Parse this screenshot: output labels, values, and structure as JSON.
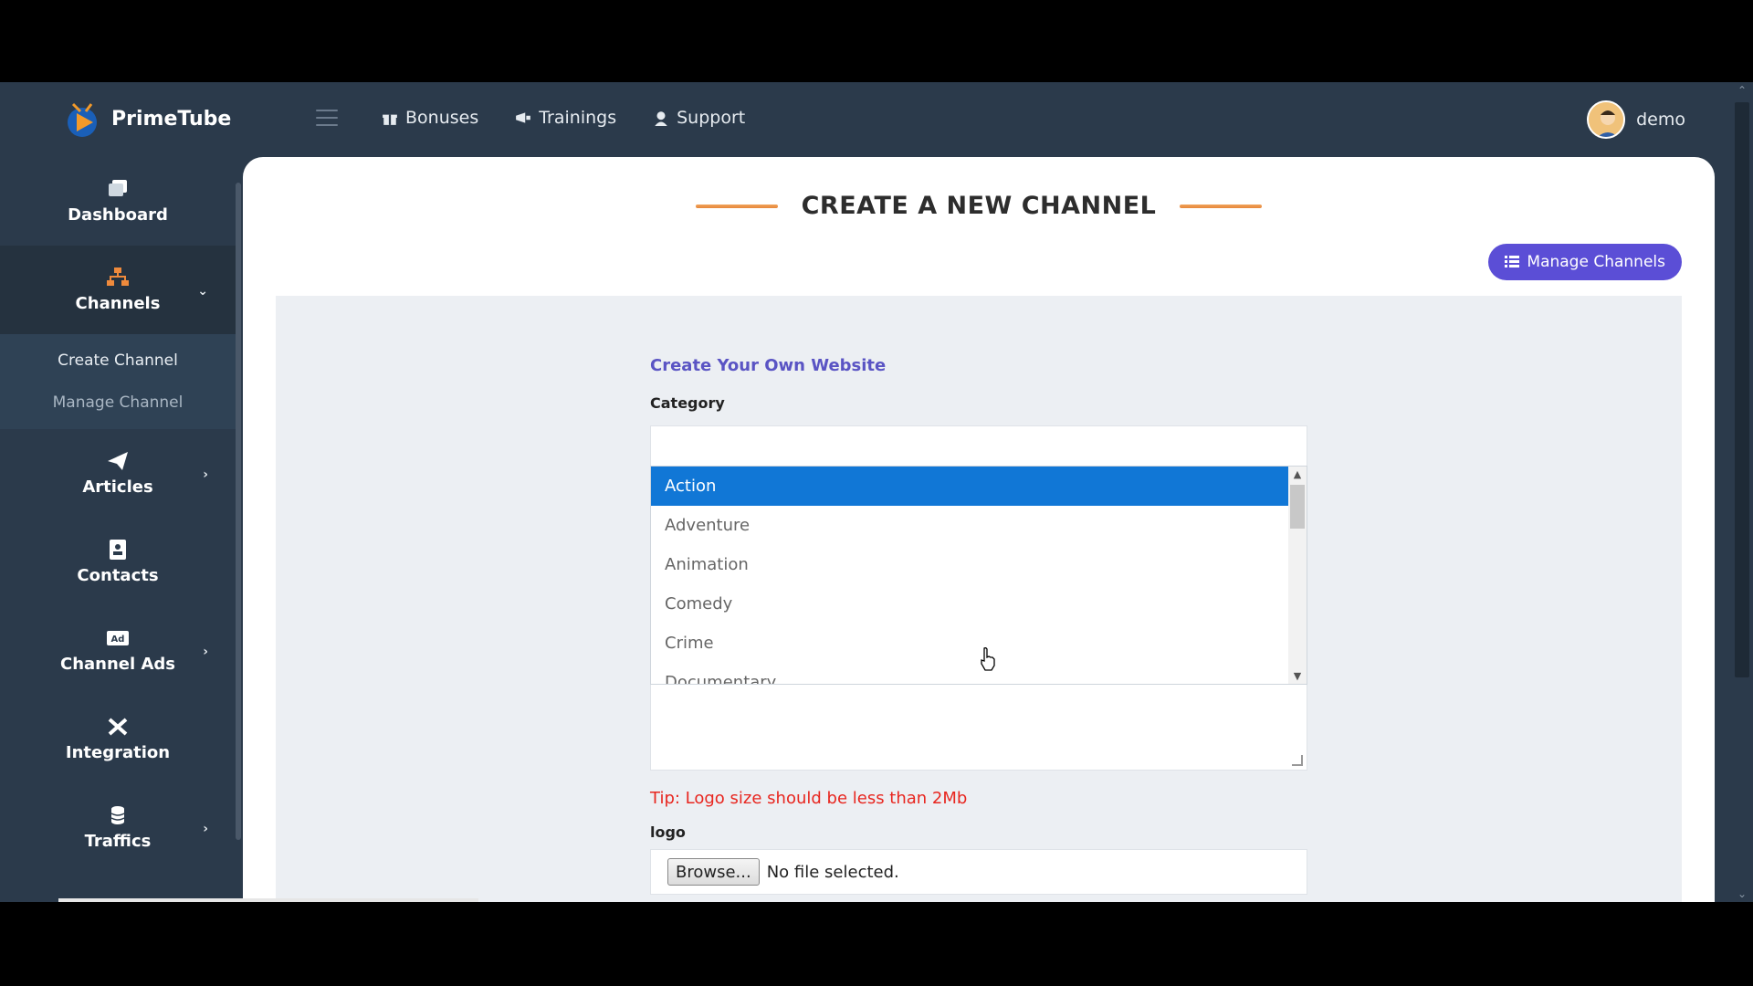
{
  "app": {
    "name": "PrimeTube"
  },
  "topnav": [
    {
      "label": "Bonuses",
      "icon": "gift-icon"
    },
    {
      "label": "Trainings",
      "icon": "megaphone-icon"
    },
    {
      "label": "Support",
      "icon": "support-icon"
    }
  ],
  "user": {
    "name": "demo"
  },
  "sidebar": {
    "items": [
      {
        "label": "Dashboard",
        "icon": "dashboard-icon"
      },
      {
        "label": "Channels",
        "icon": "sitemap-icon"
      },
      {
        "label": "Articles",
        "icon": "paper-plane-icon"
      },
      {
        "label": "Contacts",
        "icon": "contact-card-icon"
      },
      {
        "label": "Channel Ads",
        "icon": "ad-icon"
      },
      {
        "label": "Integration",
        "icon": "tools-icon"
      },
      {
        "label": "Traffics",
        "icon": "database-icon"
      }
    ],
    "channels_sub": [
      "Create Channel",
      "Manage Channel"
    ]
  },
  "page": {
    "title": "CREATE A NEW CHANNEL",
    "manage_button": "Manage Channels"
  },
  "form": {
    "title": "Create Your Own Website",
    "category_label": "Category",
    "options": [
      "Action",
      "Adventure",
      "Animation",
      "Comedy",
      "Crime",
      "Documentary"
    ],
    "selected": "Action",
    "tip": "Tip: Logo size should be less than 2Mb",
    "logo_label": "logo",
    "browse_label": "Browse...",
    "no_file": "No file selected."
  },
  "colors": {
    "accent": "#5b4ed6",
    "selected_option": "#1177d6",
    "tip": "#e8261f",
    "title_line": "#e6863a"
  }
}
